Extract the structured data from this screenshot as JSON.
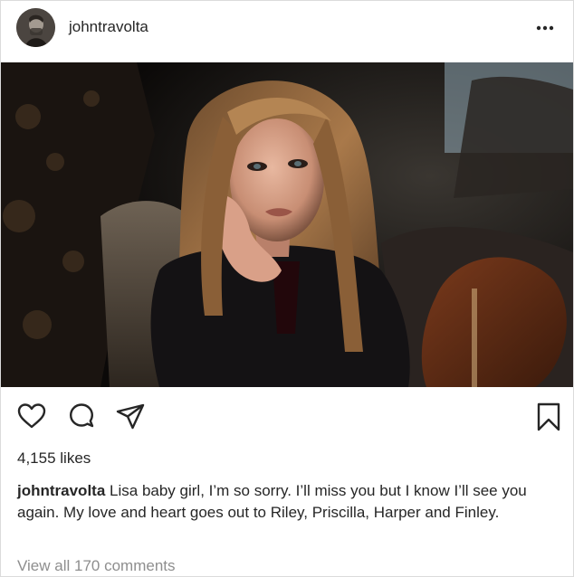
{
  "post": {
    "username": "johntravolta",
    "likes_text": "4,155 likes",
    "caption": {
      "username": "johntravolta",
      "text": "Lisa baby girl, I’m so sorry. I’ll miss you but I know I’ll see you again. My love and heart goes out to Riley, Priscilla, Harper and Finley."
    },
    "view_comments_text": "View all 170 comments"
  },
  "icons": {
    "more": "more-options-icon",
    "like": "heart-icon",
    "comment": "comment-bubble-icon",
    "share": "paper-plane-icon",
    "save": "bookmark-icon"
  },
  "colors": {
    "text": "#262626",
    "muted": "#8e8e8e",
    "border": "#dbdbdb",
    "background": "#ffffff"
  }
}
